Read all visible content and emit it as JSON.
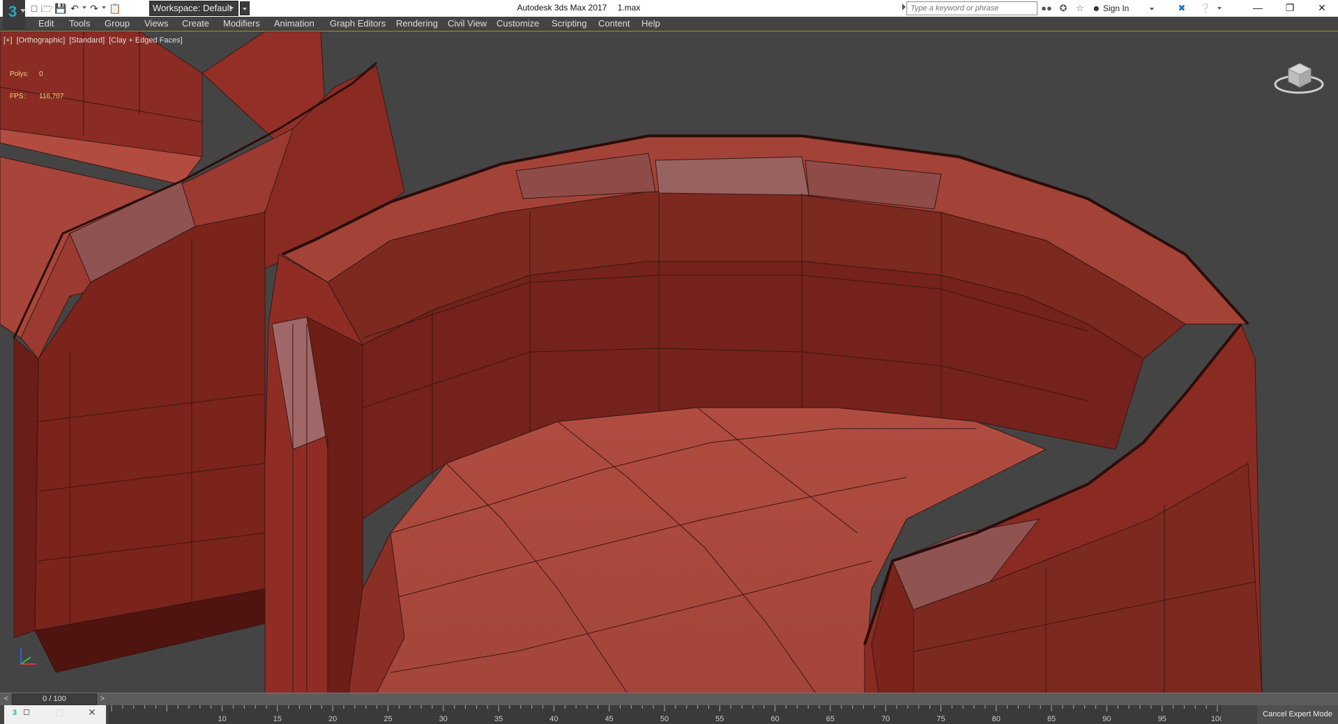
{
  "title_bar": {
    "app_title": "Autodesk 3ds Max 2017",
    "file_name": "1.max",
    "workspace": "Workspace: Default",
    "search_placeholder": "Type a keyword or phrase",
    "sign_in": "Sign In"
  },
  "menu": [
    "Edit",
    "Tools",
    "Group",
    "Views",
    "Create",
    "Modifiers",
    "Animation",
    "Graph Editors",
    "Rendering",
    "Civil View",
    "Customize",
    "Scripting",
    "Content",
    "Help"
  ],
  "viewport": {
    "labels": [
      "[+]",
      "[Orthographic]",
      "[Standard]",
      "[Clay + Edged Faces]"
    ],
    "stats": {
      "polys_label": "Polys:",
      "polys_value": "0",
      "fps_label": "FPS:",
      "fps_value": "116,707"
    }
  },
  "timeline": {
    "slider_value": "0 / 100",
    "prev": "<",
    "next": ">",
    "ticks": [
      "10",
      "15",
      "20",
      "25",
      "30",
      "35",
      "40",
      "45",
      "50",
      "55",
      "60",
      "65",
      "70",
      "75",
      "80",
      "85",
      "90",
      "95",
      "100"
    ],
    "frame_max": 100
  },
  "status": {
    "cancel_expert": "Cancel Expert Mode"
  },
  "colors": {
    "model": "#a8453b",
    "viewport_bg": "#444444",
    "accent_logo": "#23a8c9",
    "stats_text": "#e8d77a"
  }
}
